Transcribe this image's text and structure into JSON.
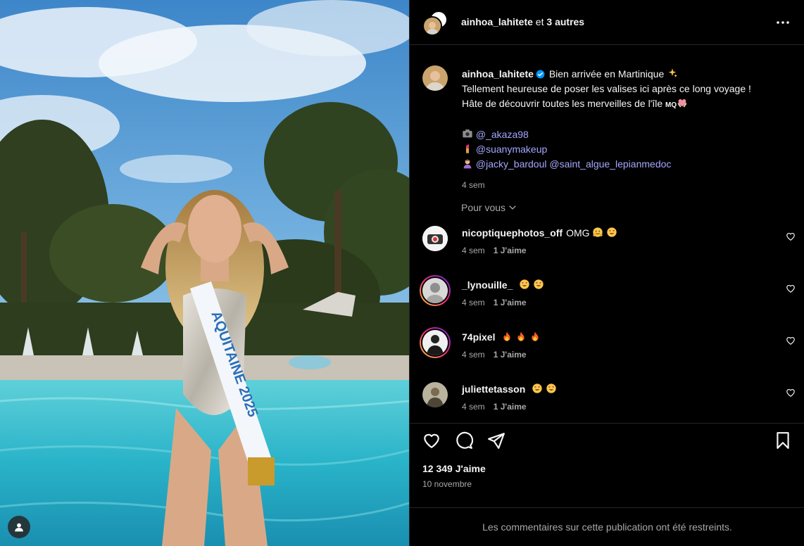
{
  "header": {
    "username": "ainhoa_lahitete",
    "separator": " et ",
    "others": "3 autres"
  },
  "caption": {
    "username": "ainhoa_lahitete",
    "line1": "Bien arrivée en Martinique",
    "line2": "Tellement heureuse de poser les valises ici après ce long voyage !",
    "line3": "Hâte de découvrir toutes les merveilles de l'île",
    "flag_text": "MQ",
    "credits": [
      {
        "icon": "camera-emoji",
        "mentions": [
          "@_akaza98"
        ]
      },
      {
        "icon": "lipstick-emoji",
        "mentions": [
          "@suanymakeup"
        ]
      },
      {
        "icon": "haircut-emoji",
        "mentions": [
          "@jacky_bardoul",
          "@saint_algue_lepianmedoc"
        ]
      }
    ],
    "time": "4 sem"
  },
  "for_you_label": "Pour vous",
  "comments": [
    {
      "username": "nicoptiquephotos_off",
      "text": "OMG",
      "emojis": [
        "hugging-face-emoji",
        "heart-eyes-emoji"
      ],
      "time": "4 sem",
      "likes": "1 J'aime"
    },
    {
      "username": "_lynouille_",
      "text": "",
      "emojis": [
        "heart-eyes-emoji",
        "heart-eyes-emoji"
      ],
      "time": "4 sem",
      "likes": "1 J'aime"
    },
    {
      "username": "74pixel",
      "text": "",
      "emojis": [
        "fire-emoji",
        "fire-emoji",
        "fire-emoji"
      ],
      "time": "4 sem",
      "likes": "1 J'aime"
    },
    {
      "username": "juliettetasson",
      "text": "",
      "emojis": [
        "heart-eyes-emoji",
        "heart-eyes-emoji"
      ],
      "time": "4 sem",
      "likes": "1 J'aime"
    }
  ],
  "post": {
    "likes": "12 349 J'aime",
    "date": "10 novembre"
  },
  "restricted_notice": "Les commentaires sur cette publication ont été restreints.",
  "colors": {
    "background": "#000000",
    "mention": "#a3a7ff",
    "muted": "#a8a8a8",
    "verified": "#0095f6"
  }
}
